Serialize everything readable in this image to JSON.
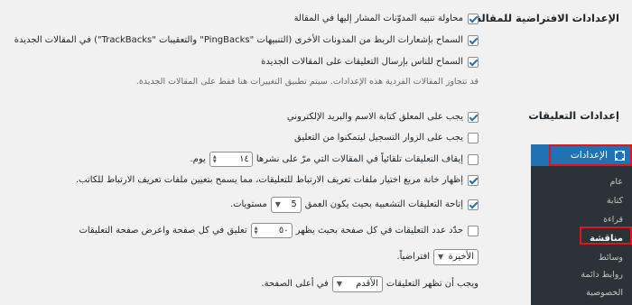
{
  "default_settings": {
    "title": "الإعدادات الافتراضية للمقالة",
    "options": [
      {
        "label": "محاولة تنبيه المدوّنات المشار إليها في المقالة",
        "checked": true
      },
      {
        "label": "السماح بإشعارات الربط من المدونات الأخرى (التنبيهات \"PingBacks\" والتعقيبات \"TrackBacks\") في المقالات الجديدة",
        "checked": true
      },
      {
        "label": "السماح للناس بإرسال التعليقات على المقالات الجديدة",
        "checked": true
      }
    ],
    "note": "قد تتجاوز المقالات الفردية هذه الإعدادات. سيتم تطبيق التغييرات هنا فقط على المقالات الجديدة."
  },
  "comment_settings": {
    "title": "إعدادات التعليقات",
    "require_name_email": {
      "label": "يجب على المعلق كتابة الاسم والبريد الإلكتروني",
      "checked": true
    },
    "require_registration": {
      "label": "يجب على الزوار التسجيل ليتمكنوا من التعليق",
      "checked": false
    },
    "auto_close": {
      "label_before": "إيقاف التعليقات تلقائياً في المقالات التي مرّ على نشرها",
      "value": "١٤",
      "label_after": "يوم.",
      "checked": false
    },
    "cookies_opt_in": {
      "label": "إظهار خانة مربع اختيار ملفات تعريف الارتباط للتعليقات، مما يسمح بتعيين ملفات تعريف الارتباط للكاتب.",
      "checked": true
    },
    "threaded": {
      "label_before": "إتاحة التعليقات التشعبية بحيث يكون العمق",
      "value": "5",
      "label_after": "مستويات.",
      "checked": true
    },
    "paginate": {
      "label_before": "حدّد عدد التعليقات في كل صفحة بحيث يظهر",
      "value": "٥٠",
      "label_after": "تعليق في كل صفحة واعرض صفحة التعليقات",
      "checked": false
    },
    "default_page": {
      "value": "الأخيرة",
      "label_after": "افتراضياً."
    },
    "order": {
      "label_before": "ويجب أن تظهر التعليقات",
      "value": "الأقدم",
      "label_after": "في أعلى الصفحة."
    }
  },
  "admin_menu": {
    "header": "الإعدادات",
    "items": [
      "عام",
      "كتابة",
      "قراءة",
      "مناقشة",
      "وسائط",
      "روابط دائمة",
      "الخصوصية"
    ],
    "current_index": 3
  },
  "colors": {
    "accent": "#2271b1",
    "highlight": "#e3141b",
    "menu_bg": "#2c3338"
  }
}
